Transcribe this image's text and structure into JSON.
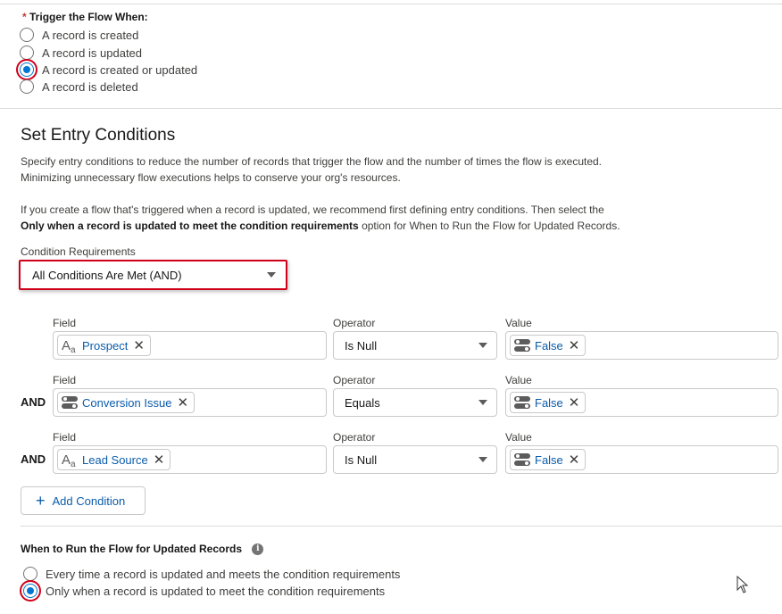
{
  "trigger": {
    "required_mark": "*",
    "label": "Trigger the Flow When:",
    "options": [
      {
        "label": "A record is created",
        "checked": false
      },
      {
        "label": "A record is updated",
        "checked": false
      },
      {
        "label": "A record is created or updated",
        "checked": true
      },
      {
        "label": "A record is deleted",
        "checked": false
      }
    ]
  },
  "entry_conditions": {
    "title": "Set Entry Conditions",
    "description_1": "Specify entry conditions to reduce the number of records that trigger the flow and the number of times the flow is executed.",
    "description_2": "Minimizing unnecessary flow executions helps to conserve your org's resources.",
    "note_1": "If you create a flow that's triggered when a record is updated, we recommend first defining entry conditions. Then select the",
    "note_bold": "Only when a record is updated to meet the condition requirements",
    "note_2": "option for When to Run the Flow for Updated Records.",
    "requirements_label": "Condition Requirements",
    "requirements_value": "All Conditions Are Met (AND)"
  },
  "conditions": {
    "field_label": "Field",
    "operator_label": "Operator",
    "value_label": "Value",
    "rows": [
      {
        "connector": "",
        "field": "Prospect",
        "field_icon": "text-icon",
        "operator": "Is Null",
        "value": "False",
        "value_icon": "toggle-icon"
      },
      {
        "connector": "AND",
        "field": "Conversion Issue",
        "field_icon": "toggle-icon",
        "operator": "Equals",
        "value": "False",
        "value_icon": "toggle-icon"
      },
      {
        "connector": "AND",
        "field": "Lead Source",
        "field_icon": "text-icon",
        "operator": "Is Null",
        "value": "False",
        "value_icon": "toggle-icon"
      }
    ],
    "add_button": "Add Condition"
  },
  "run_when": {
    "label": "When to Run the Flow for Updated Records",
    "info_glyph": "i",
    "options": [
      {
        "label": "Every time a record is updated and meets the condition requirements",
        "checked": false
      },
      {
        "label": "Only when a record is updated to meet the condition requirements",
        "checked": true
      }
    ]
  },
  "colors": {
    "accent": "#0176d3",
    "link": "#0b5cab",
    "highlight": "#d0021b"
  }
}
